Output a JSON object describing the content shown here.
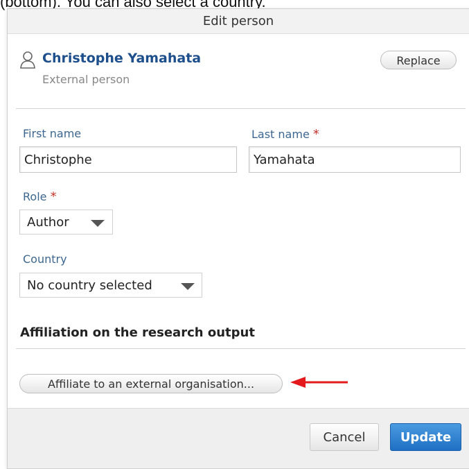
{
  "snippet": {
    "text": "(bottom). You can also select a country."
  },
  "dialog": {
    "title": "Edit person",
    "person": {
      "name": "Christophe Yamahata",
      "type": "External person",
      "icon": "person-icon"
    },
    "replace_label": "Replace",
    "form": {
      "first_name": {
        "label": "First name",
        "value": "Christophe"
      },
      "last_name": {
        "label": "Last name",
        "required_mark": "*",
        "value": "Yamahata"
      },
      "role": {
        "label": "Role",
        "required_mark": "*",
        "selected": "Author"
      },
      "country": {
        "label": "Country",
        "selected": "No country selected"
      }
    },
    "affiliation": {
      "title": "Affiliation on the research output",
      "button_label": "Affiliate to an external organisation...",
      "annotation_arrow_color": "#e3191b"
    },
    "footer": {
      "cancel_label": "Cancel",
      "update_label": "Update"
    },
    "colors": {
      "link": "#1d4f8c",
      "label": "#3d6790",
      "required": "#c0362c",
      "primary": "#1f6fc4"
    }
  }
}
